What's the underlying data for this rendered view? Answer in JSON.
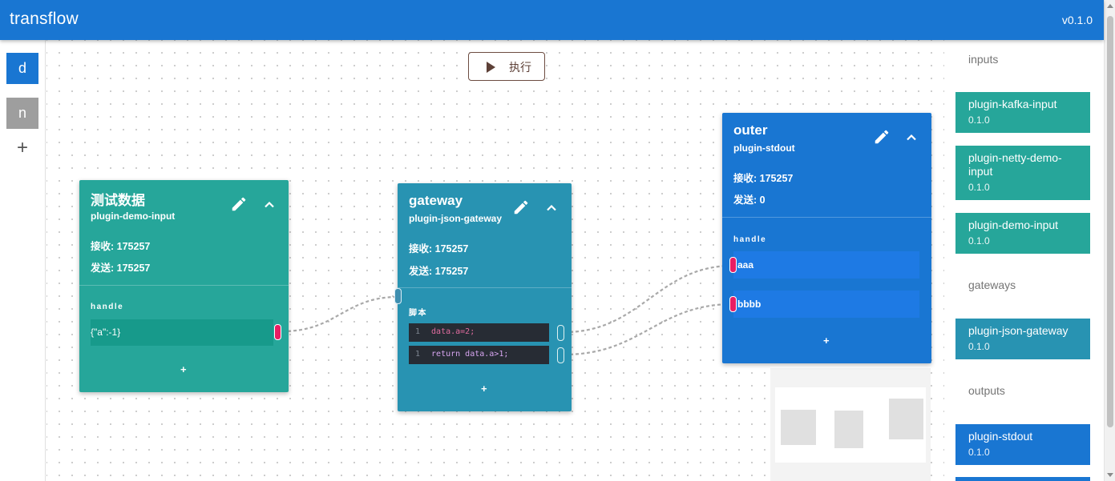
{
  "app": {
    "title": "transflow",
    "version": "v0.1.0"
  },
  "workspaces": [
    {
      "label": "d",
      "color": "#1976d2"
    },
    {
      "label": "n",
      "color": "#9e9e9e"
    }
  ],
  "workspace_add": "+",
  "toolbar": {
    "run_label": "执行"
  },
  "nodes": {
    "input": {
      "title": "测试数据",
      "plugin": "plugin-demo-input",
      "received": "接收:  175257",
      "sent": "发送:  175257",
      "section": "handle",
      "handles": [
        "{\"a\":-1}"
      ],
      "add": "+",
      "color": "#26a69a"
    },
    "gateway": {
      "title": "gateway",
      "plugin": "plugin-json-gateway",
      "received": "接收:  175257",
      "sent": "发送:  175257",
      "section": "脚本",
      "scripts": [
        {
          "line": "1",
          "code": "data.a=2;"
        },
        {
          "line": "1",
          "code": "return data.a>1;"
        }
      ],
      "add": "+",
      "color": "#2893b2"
    },
    "output": {
      "title": "outer",
      "plugin": "plugin-stdout",
      "received": "接收:  175257",
      "sent": "发送:  0",
      "section": "handle",
      "handles": [
        "aaa",
        "bbbb"
      ],
      "add": "+",
      "color": "#1976d2"
    }
  },
  "plugins": {
    "inputs_label": "inputs",
    "inputs": [
      {
        "name": "plugin-kafka-input",
        "version": "0.1.0"
      },
      {
        "name": "plugin-netty-demo-input",
        "version": "0.1.0"
      },
      {
        "name": "plugin-demo-input",
        "version": "0.1.0"
      }
    ],
    "gateways_label": "gateways",
    "gateways": [
      {
        "name": "plugin-json-gateway",
        "version": "0.1.0"
      }
    ],
    "outputs_label": "outputs",
    "outputs": [
      {
        "name": "plugin-stdout",
        "version": "0.1.0"
      }
    ]
  },
  "icons": [
    "play-icon",
    "edit-icon",
    "chevron-up-icon"
  ],
  "colors": {
    "primary": "#1976d2",
    "teal": "#26a69a",
    "cyan": "#2893b2",
    "port": "#e91e63"
  }
}
